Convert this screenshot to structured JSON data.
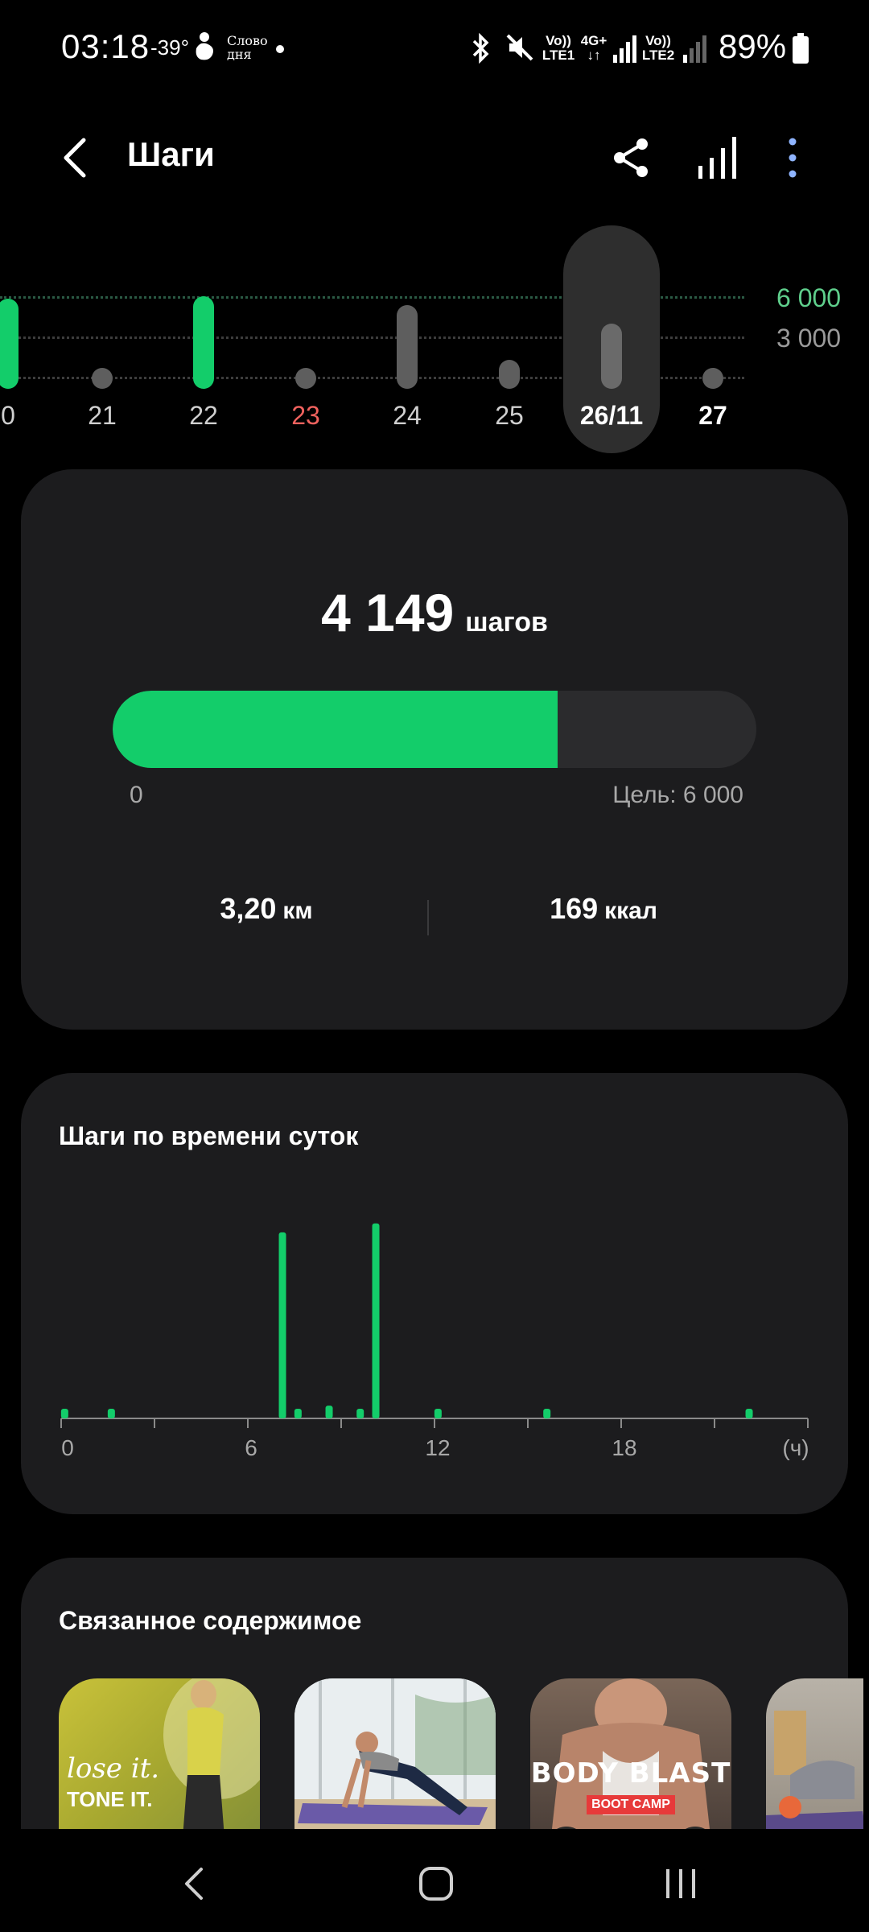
{
  "status_bar": {
    "time": "03:18",
    "temperature": "-39°",
    "word_of_day": [
      "Слово",
      "дня"
    ],
    "network1_top": "Vo))",
    "network1_bottom": "LTE1",
    "network_type": "4G+",
    "network2_top": "Vo))",
    "network2_bottom": "LTE2",
    "battery": "89%"
  },
  "header": {
    "title": "Шаги"
  },
  "date_strip": {
    "goal_high": "6 000",
    "goal_low": "3 000",
    "days": [
      {
        "label": "0",
        "steps": 6000,
        "color": "#13cd6a",
        "label_color": "#d0d0d0"
      },
      {
        "label": "21",
        "steps": 0,
        "color": "#5e5e5e",
        "label_color": "#d0d0d0"
      },
      {
        "label": "22",
        "steps": 6200,
        "color": "#13cd6a",
        "label_color": "#d0d0d0"
      },
      {
        "label": "23",
        "steps": 0,
        "color": "#5e5e5e",
        "label_color": "#f0625e"
      },
      {
        "label": "24",
        "steps": 5500,
        "color": "#5e5e5e",
        "label_color": "#d0d0d0"
      },
      {
        "label": "25",
        "steps": 1400,
        "color": "#5e5e5e",
        "label_color": "#d0d0d0"
      },
      {
        "label": "26/11",
        "steps": 4149,
        "color": "#6a6a6a",
        "label_color": "#ffffff",
        "selected": true
      },
      {
        "label": "27",
        "steps": 0,
        "color": "#5e5e5e",
        "label_color": "#ffffff"
      }
    ]
  },
  "steps_card": {
    "value": "4 149",
    "unit": "шагов",
    "progress_fraction": 0.6915,
    "progress_min": "0",
    "progress_goal": "Цель: 6 000",
    "distance_value": "3,20",
    "distance_unit": "км",
    "calories_value": "169",
    "calories_unit": "ккал"
  },
  "hourly_card": {
    "title": "Шаги по времени суток",
    "chart_data": {
      "type": "bar",
      "x_ticks": [
        "0",
        "6",
        "12",
        "18"
      ],
      "x_unit": "(ч)",
      "xlim": [
        0,
        24
      ],
      "color": "#13cd6a",
      "bars": [
        {
          "hour": 0.1,
          "value": 40
        },
        {
          "hour": 1.6,
          "value": 40
        },
        {
          "hour": 7.1,
          "value": 1450
        },
        {
          "hour": 7.6,
          "value": 50
        },
        {
          "hour": 8.6,
          "value": 100
        },
        {
          "hour": 9.6,
          "value": 50
        },
        {
          "hour": 10.1,
          "value": 1520
        },
        {
          "hour": 12.1,
          "value": 40
        },
        {
          "hour": 15.6,
          "value": 40
        },
        {
          "hour": 22.1,
          "value": 40
        }
      ]
    }
  },
  "related_card": {
    "title": "Связанное содержимое",
    "items": [
      {
        "text1": "lose it.",
        "text2": "TONE IT."
      },
      {
        "text1": "",
        "text2": ""
      },
      {
        "text1": "BODY BLAST",
        "text2": "BOOT CAMP"
      },
      {
        "text1": "",
        "text2": ""
      }
    ]
  }
}
